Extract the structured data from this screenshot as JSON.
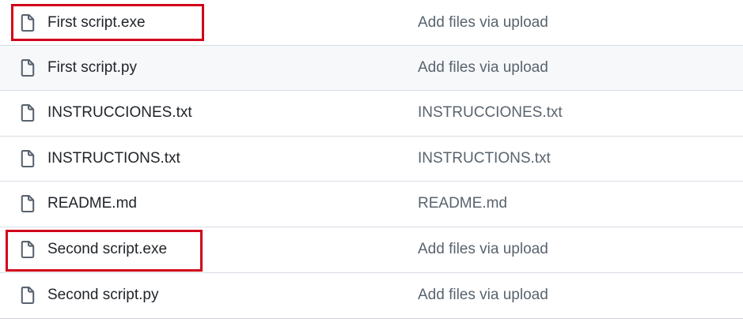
{
  "files": [
    {
      "name": "First script.exe",
      "commit_message": "Add files via upload",
      "highlighted": true
    },
    {
      "name": "First script.py",
      "commit_message": "Add files via upload",
      "highlighted": false
    },
    {
      "name": "INSTRUCCIONES.txt",
      "commit_message": "INSTRUCCIONES.txt",
      "highlighted": false
    },
    {
      "name": "INSTRUCTIONS.txt",
      "commit_message": "INSTRUCTIONS.txt",
      "highlighted": false
    },
    {
      "name": "README.md",
      "commit_message": "README.md",
      "highlighted": false
    },
    {
      "name": "Second script.exe",
      "commit_message": "Add files via upload",
      "highlighted": true
    },
    {
      "name": "Second script.py",
      "commit_message": "Add files via upload",
      "highlighted": false
    }
  ],
  "colors": {
    "highlight": "#d0021b",
    "row_hover": "#f6f8fa",
    "filename": "#1f2328",
    "commit_message": "#59636e"
  },
  "icons": {
    "file": "file-icon"
  }
}
